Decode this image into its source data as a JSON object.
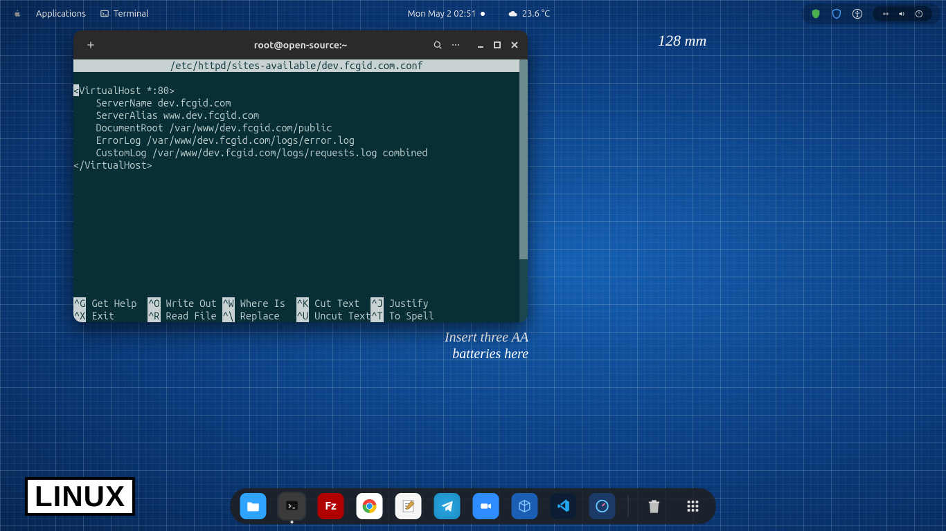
{
  "topbar": {
    "applications": "Applications",
    "app_running": "Terminal",
    "datetime": "Mon May 2  02:51",
    "weather_temp": "23.6 °C"
  },
  "tray": {
    "icons": [
      "shield-green-icon",
      "shield-blue-icon",
      "accessibility-icon",
      "network-icon",
      "volume-icon",
      "power-icon"
    ]
  },
  "terminal": {
    "title": "root@open-source:~",
    "nano_header": "/etc/httpd/sites-available/dev.fcgid.com.conf",
    "content_lines": [
      "<VirtualHost *:80>",
      "    ServerName dev.fcgid.com",
      "    ServerAlias www.dev.fcgid.com",
      "    DocumentRoot /var/www/dev.fcgid.com/public",
      "    ErrorLog /var/www/dev.fcgid.com/logs/error.log",
      "    CustomLog /var/www/dev.fcgid.com/logs/requests.log combined",
      "</VirtualHost>"
    ],
    "menu": [
      {
        "k": "^G",
        "l": "Get Help"
      },
      {
        "k": "^O",
        "l": "Write Out"
      },
      {
        "k": "^W",
        "l": "Where Is"
      },
      {
        "k": "^K",
        "l": "Cut Text"
      },
      {
        "k": "^J",
        "l": "Justify"
      },
      {
        "k": "",
        "l": ""
      },
      {
        "k": "^X",
        "l": "Exit"
      },
      {
        "k": "^R",
        "l": "Read File"
      },
      {
        "k": "^\\",
        "l": "Replace"
      },
      {
        "k": "^U",
        "l": "Uncut Text"
      },
      {
        "k": "^T",
        "l": "To Spell"
      },
      {
        "k": "",
        "l": ""
      }
    ]
  },
  "wallpaper": {
    "dimension_label": "128 mm",
    "battery_label_l1": "Insert three AA",
    "battery_label_l2": "batteries here",
    "badge": "LINUX"
  },
  "dock": {
    "items": [
      "files",
      "terminal",
      "filezilla",
      "chrome",
      "text-editor",
      "telegram",
      "zoom",
      "virtualbox",
      "vscode",
      "corectrl"
    ],
    "trash": "trash",
    "apps_grid": "apps-grid"
  }
}
